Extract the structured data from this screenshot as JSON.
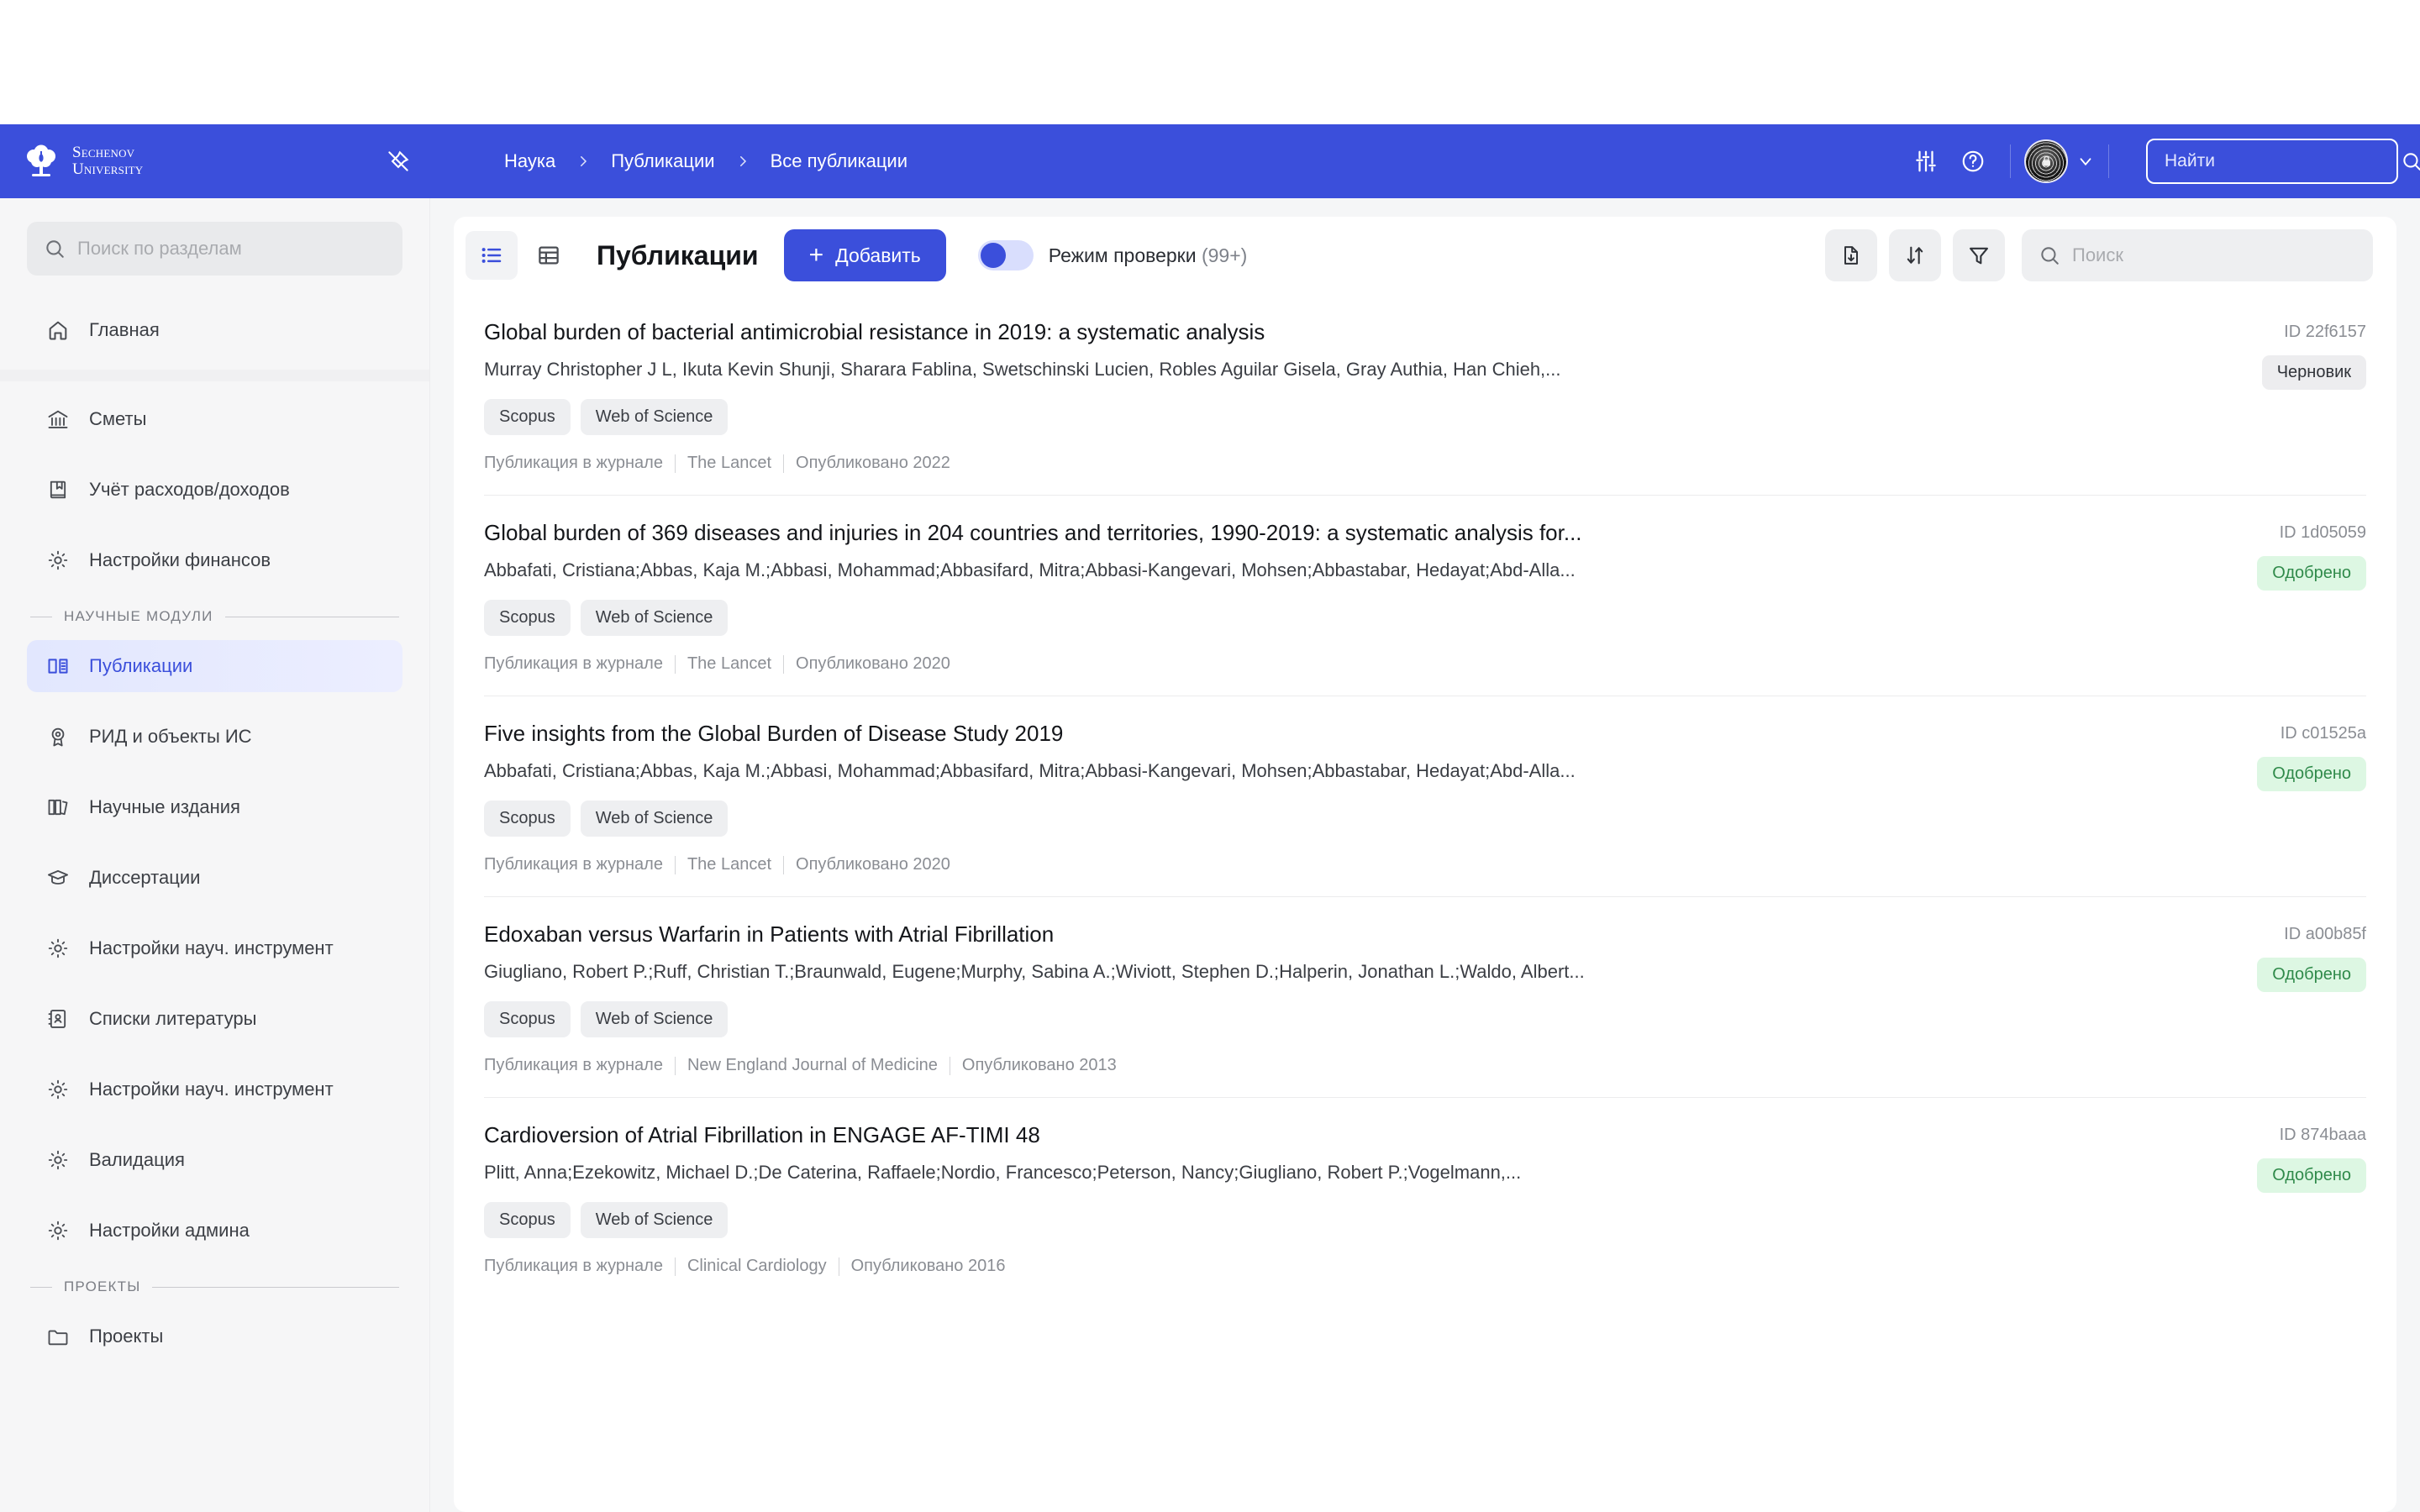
{
  "brand": {
    "line1": "Sechenov",
    "line2": "University",
    "logo_icon": "tree-logo-icon"
  },
  "header": {
    "pin_icon": "pin-off-icon",
    "breadcrumb": [
      "Наука",
      "Публикации",
      "Все публикации"
    ],
    "settings_icon": "sliders-icon",
    "help_icon": "question-circle-icon",
    "avatar_icon": "fingerprint-lock-avatar",
    "chevron_icon": "chevron-down-icon",
    "search": {
      "placeholder": "Найти",
      "value": "",
      "icon": "search-icon"
    },
    "accent_color": "#3b4fdb"
  },
  "sidebar": {
    "search": {
      "placeholder": "Поиск по разделам",
      "value": "",
      "icon": "search-icon"
    },
    "home": {
      "label": "Главная",
      "icon": "home-icon"
    },
    "finance_items": [
      {
        "label": "Сметы",
        "icon": "bank-icon"
      },
      {
        "label": "Учёт расходов/доходов",
        "icon": "book-icon"
      },
      {
        "label": "Настройки финансов",
        "icon": "gear-icon"
      }
    ],
    "groups": [
      {
        "title": "НАУЧНЫЕ МОДУЛИ",
        "items": [
          {
            "label": "Публикации",
            "icon": "book-open-icon",
            "active": true
          },
          {
            "label": "РИД и объекты ИС",
            "icon": "award-icon",
            "active": false
          },
          {
            "label": "Научные издания",
            "icon": "books-icon",
            "active": false
          },
          {
            "label": "Диссертации",
            "icon": "graduation-cap-icon",
            "active": false
          },
          {
            "label": "Настройки науч. инструмент",
            "icon": "gear-icon",
            "active": false
          },
          {
            "label": "Списки литературы",
            "icon": "contact-book-icon",
            "active": false
          },
          {
            "label": "Настройки науч. инструмент",
            "icon": "gear-icon",
            "active": false
          },
          {
            "label": "Валидация",
            "icon": "gear-icon",
            "active": false
          },
          {
            "label": "Настройки админа",
            "icon": "gear-icon",
            "active": false
          }
        ]
      },
      {
        "title": "ПРОЕКТЫ",
        "items": [
          {
            "label": "Проекты",
            "icon": "folder-icon",
            "active": false
          }
        ]
      }
    ]
  },
  "toolbar": {
    "view_list_icon": "list-view-icon",
    "view_table_icon": "table-view-icon",
    "title": "Публикации",
    "add_label": "Добавить",
    "add_plus": "+",
    "check_mode_label": "Режим проверки",
    "check_mode_count": "(99+)",
    "check_mode_on": true,
    "export_icon": "file-download-icon",
    "sort_icon": "sort-arrows-icon",
    "filter_icon": "funnel-icon",
    "search": {
      "placeholder": "Поиск",
      "value": "",
      "icon": "search-icon"
    }
  },
  "publications": [
    {
      "title": "Global burden of bacterial antimicrobial resistance in 2019: a systematic analysis",
      "authors": "Murray Christopher J L, Ikuta Kevin Shunji, Sharara Fablina, Swetschinski Lucien, Robles Aguilar Gisela, Gray Authia, Han Chieh,...",
      "tags": [
        "Scopus",
        "Web of Science"
      ],
      "type": "Публикация в журнале",
      "journal": "The Lancet",
      "published": "Опубликовано 2022",
      "id": "ID 22f6157",
      "status": "Черновик",
      "status_kind": "draft"
    },
    {
      "title": "Global burden of 369 diseases and injuries in 204 countries and territories, 1990-2019: a systematic analysis for...",
      "authors": "Abbafati, Cristiana;Abbas, Kaja M.;Abbasi, Mohammad;Abbasifard, Mitra;Abbasi-Kangevari, Mohsen;Abbastabar, Hedayat;Abd-Alla...",
      "tags": [
        "Scopus",
        "Web of Science"
      ],
      "type": "Публикация в журнале",
      "journal": "The Lancet",
      "published": "Опубликовано 2020",
      "id": "ID 1d05059",
      "status": "Одобрено",
      "status_kind": "approved"
    },
    {
      "title": "Five insights from the Global Burden of Disease Study 2019",
      "authors": "Abbafati, Cristiana;Abbas, Kaja M.;Abbasi, Mohammad;Abbasifard, Mitra;Abbasi-Kangevari, Mohsen;Abbastabar, Hedayat;Abd-Alla...",
      "tags": [
        "Scopus",
        "Web of Science"
      ],
      "type": "Публикация в журнале",
      "journal": "The Lancet",
      "published": "Опубликовано 2020",
      "id": "ID c01525a",
      "status": "Одобрено",
      "status_kind": "approved"
    },
    {
      "title": "Edoxaban versus Warfarin in Patients with Atrial Fibrillation",
      "authors": "Giugliano, Robert P.;Ruff, Christian T.;Braunwald, Eugene;Murphy, Sabina A.;Wiviott, Stephen D.;Halperin, Jonathan L.;Waldo, Albert...",
      "tags": [
        "Scopus",
        "Web of Science"
      ],
      "type": "Публикация в журнале",
      "journal": "New England Journal of Medicine",
      "published": "Опубликовано 2013",
      "id": "ID a00b85f",
      "status": "Одобрено",
      "status_kind": "approved"
    },
    {
      "title": "Cardioversion of Atrial Fibrillation in ENGAGE AF-TIMI 48",
      "authors": "Plitt, Anna;Ezekowitz, Michael D.;De Caterina, Raffaele;Nordio, Francesco;Peterson, Nancy;Giugliano, Robert P.;Vogelmann,...",
      "tags": [
        "Scopus",
        "Web of Science"
      ],
      "type": "Публикация в журнале",
      "journal": "Clinical Cardiology",
      "published": "Опубликовано 2016",
      "id": "ID 874baaa",
      "status": "Одобрено",
      "status_kind": "approved"
    }
  ]
}
